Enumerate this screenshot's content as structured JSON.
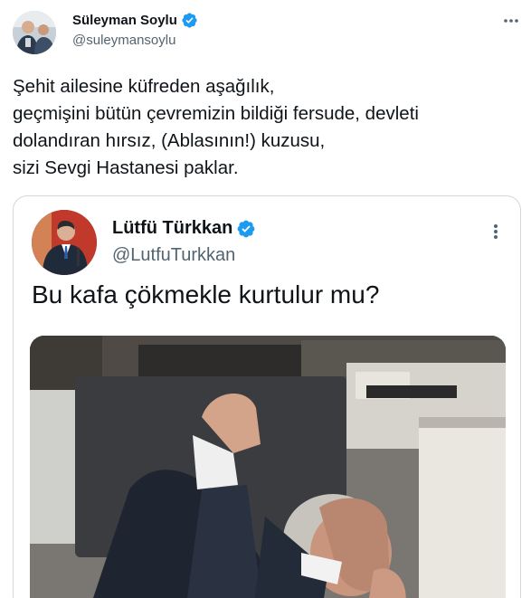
{
  "tweet": {
    "author_name": "Süleyman Soylu",
    "author_handle": "@suleymansoylu",
    "verified_icon": "verified-badge-icon",
    "more_icon": "more-options-icon",
    "text_lines": [
      "Şehit ailesine küfreden aşağılık,",
      "geçmişini bütün çevremizin bildiği fersude, devleti",
      "dolandıran hırsız, (Ablasının!) kuzusu,",
      "sizi Sevgi Hastanesi paklar."
    ]
  },
  "quoted_tweet": {
    "author_name": "Lütfü Türkkan",
    "author_handle": "@LutfuTurkkan",
    "text": "Bu kafa çökmekle kurtulur mu?",
    "media_kind": "video-still"
  },
  "colors": {
    "verified_blue": "#1d9bf0",
    "text_primary": "#0f1419",
    "text_secondary": "#536471",
    "border": "#cfd9de"
  }
}
